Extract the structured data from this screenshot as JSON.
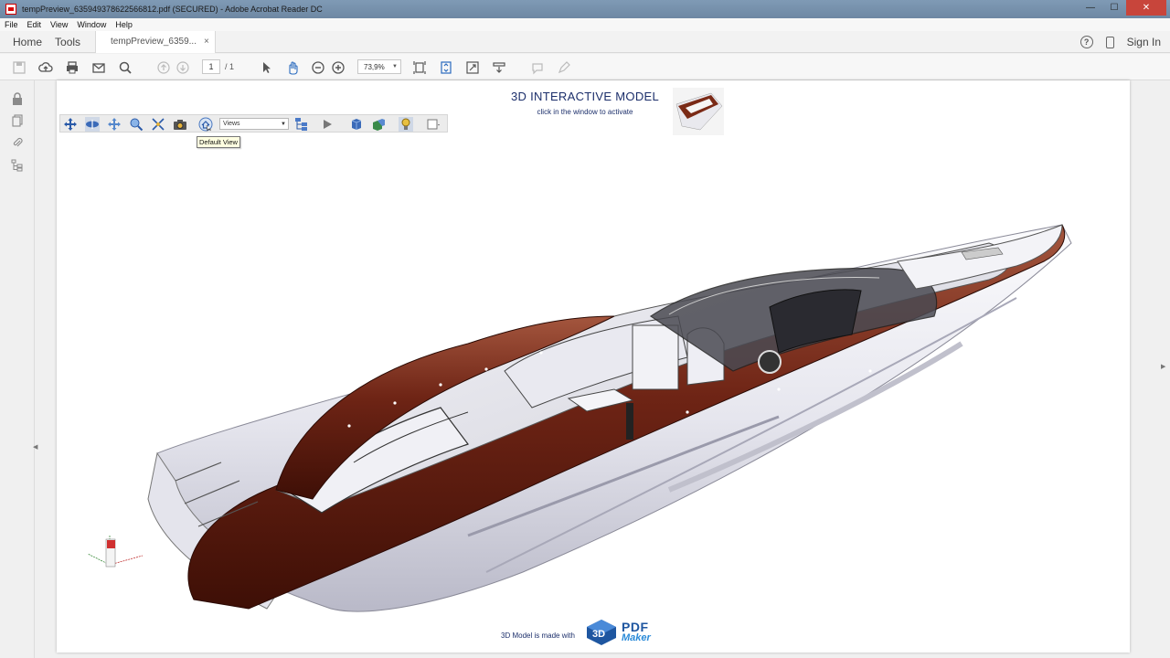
{
  "window": {
    "title": "tempPreview_635949378622566812.pdf (SECURED) - Adobe Acrobat Reader DC",
    "minimize": "—",
    "maximize": "☐",
    "close": "✕"
  },
  "menu": [
    "File",
    "Edit",
    "View",
    "Window",
    "Help"
  ],
  "tabs": {
    "home": "Home",
    "tools": "Tools",
    "document": "tempPreview_6359...",
    "close": "×",
    "sign_in": "Sign In",
    "help_icon": "?"
  },
  "toolbar": {
    "page_current": "1",
    "page_total": "/ 1",
    "zoom": "73,9%"
  },
  "document": {
    "title": "3D INTERACTIVE MODEL",
    "subtitle": "click in the window to activate",
    "views_select": "Views",
    "tooltip": "Default View",
    "footer": "3D Model is made with",
    "logo_pdf": "PDF",
    "logo_maker": "Maker",
    "logo_mark": "3D"
  },
  "colors": {
    "hull_brown": "#6e2415",
    "hull_white": "#e8e8ef",
    "brand_blue": "#1c2f6b"
  }
}
